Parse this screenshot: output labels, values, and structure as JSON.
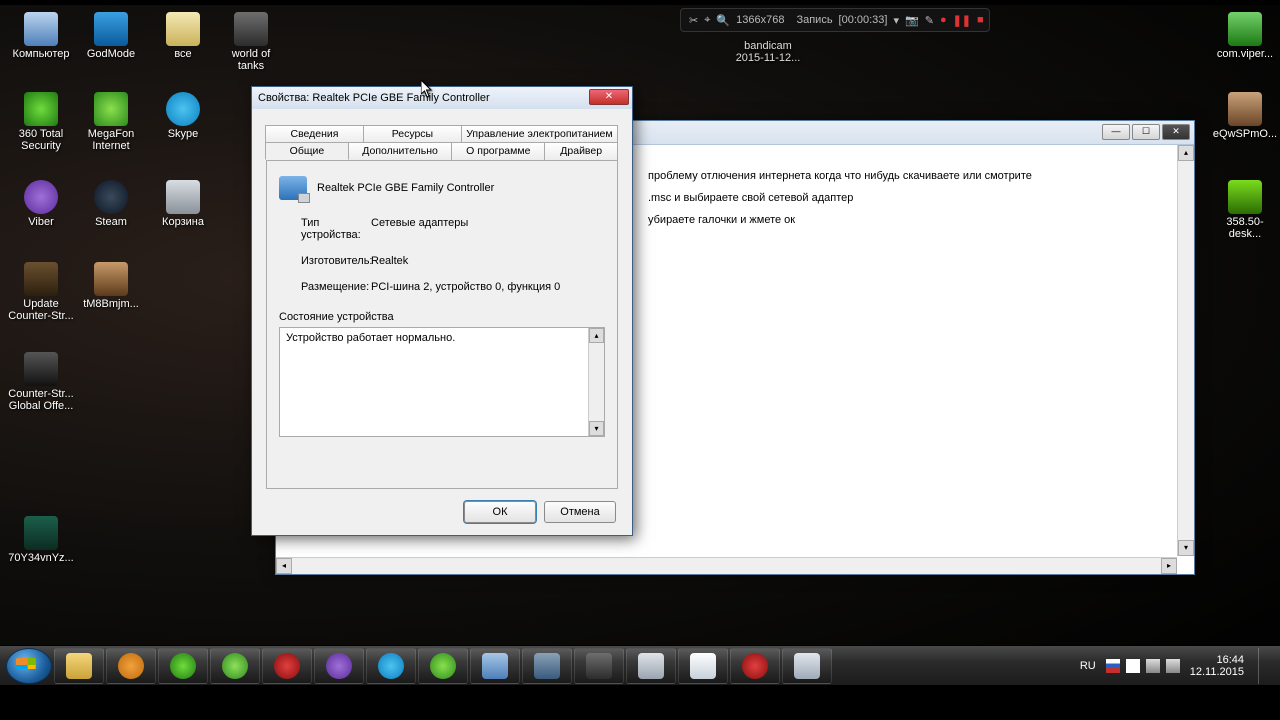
{
  "desktop_icons": {
    "computer": "Компьютер",
    "godmode": "GodMode",
    "all": "все",
    "wot": "world of tanks",
    "sec360": "360 Total Security",
    "megafon": "MegaFon Internet",
    "skype": "Skype",
    "viber": "Viber",
    "steam": "Steam",
    "trash": "Корзина",
    "updatecs": "Update Counter-Str...",
    "tm8": "tM8Bmjm...",
    "csgo": "Counter-Str... Global Offe...",
    "y34": "70Y34vnYz...",
    "eqw": "eQwSPmO...",
    "comviper": "com.viper...",
    "nvidia": "358.50-desk..."
  },
  "hud": {
    "res": "1366x768",
    "rec_label": "Запись",
    "rec_time": "[00:00:33]",
    "brand": "bandicam",
    "date": "2015-11-12..."
  },
  "notepad": {
    "line1": "проблему отлючения интернета когда что нибудь скачиваете или смотрите",
    "line2": ".msc и выбираете свой сетевой адаптер",
    "line3": "убираете галочки и жмете ок"
  },
  "props": {
    "title": "Свойства: Realtek PCIe GBE Family Controller",
    "tabs_back": {
      "details": "Сведения",
      "resources": "Ресурсы",
      "power": "Управление электропитанием"
    },
    "tabs_front": {
      "general": "Общие",
      "advanced": "Дополнительно",
      "about": "О программе",
      "driver": "Драйвер"
    },
    "dev_name": "Realtek PCIe GBE Family Controller",
    "k_type": "Тип устройства:",
    "v_type": "Сетевые адаптеры",
    "k_vendor": "Изготовитель:",
    "v_vendor": "Realtek",
    "k_loc": "Размещение:",
    "v_loc": "PCI-шина 2, устройство 0, функция 0",
    "status_label": "Состояние устройства",
    "status_text": "Устройство работает нормально.",
    "btn_ok": "ОК",
    "btn_cancel": "Отмена"
  },
  "tray": {
    "lang": "RU",
    "time": "16:44",
    "date": "12.11.2015"
  }
}
